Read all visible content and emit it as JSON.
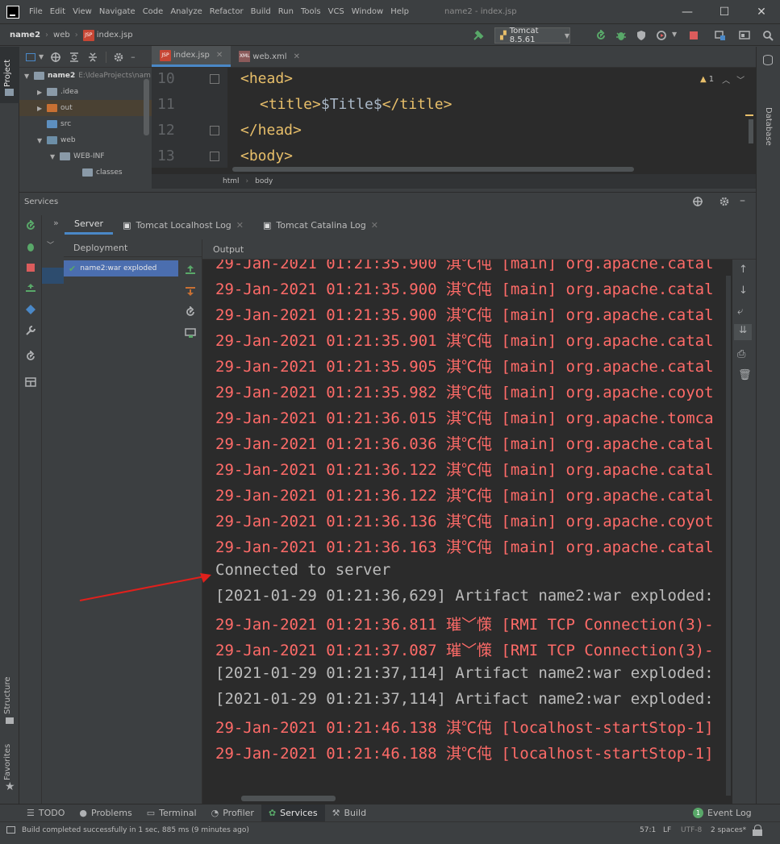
{
  "titlebar": {
    "menu": [
      "File",
      "Edit",
      "View",
      "Navigate",
      "Code",
      "Analyze",
      "Refactor",
      "Build",
      "Run",
      "Tools",
      "VCS",
      "Window",
      "Help"
    ],
    "window_title": "name2 - index.jsp",
    "minimize": "—",
    "maximize": "☐",
    "close": "✕"
  },
  "navbar": {
    "crumbs": [
      "name2",
      "web",
      "index.jsp"
    ],
    "jsp_badge": "JSP",
    "run_config": "Tomcat 8.5.61"
  },
  "left_strip": {
    "project": "Project",
    "structure": "Structure",
    "favorites": "Favorites"
  },
  "right_strip": {
    "database": "Database"
  },
  "project_tree": [
    {
      "label": "name2",
      "path": "E:\\IdeaProjects\\nam",
      "kind": "module"
    },
    {
      "label": ".idea",
      "kind": "folder"
    },
    {
      "label": "out",
      "kind": "folder-orange"
    },
    {
      "label": "src",
      "kind": "folder-blue"
    },
    {
      "label": "web",
      "kind": "folder-web"
    },
    {
      "label": "WEB-INF",
      "kind": "folder"
    },
    {
      "label": "classes",
      "kind": "folder"
    }
  ],
  "editor": {
    "tabs": [
      {
        "label": "index.jsp",
        "badge": "JSP"
      },
      {
        "label": "web.xml",
        "badge": "XML"
      }
    ],
    "warning_count": "1",
    "line_numbers": [
      "10",
      "11",
      "12",
      "13"
    ],
    "lines": [
      {
        "tag_open": "<head>",
        "text": "",
        "tag_close": ""
      },
      {
        "tag_open": "<title>",
        "text": "$Title$",
        "tag_close": "</title>"
      },
      {
        "tag_open": "</head>",
        "text": "",
        "tag_close": ""
      },
      {
        "tag_open": "<body>",
        "text": "",
        "tag_close": ""
      }
    ],
    "breadcrumb": [
      "html",
      "body"
    ]
  },
  "services": {
    "title": "Services",
    "tabs": [
      "Server",
      "Tomcat Localhost Log",
      "Tomcat Catalina Log"
    ],
    "deployment_header": "Deployment",
    "output_header": "Output",
    "deployment_item": "name2:war exploded"
  },
  "output_lines": [
    {
      "text": "29-Jan-2021 01:21:35.900 淇℃伅 [main] org.apache.catal",
      "kind": "err"
    },
    {
      "text": "29-Jan-2021 01:21:35.900 淇℃伅 [main] org.apache.catal",
      "kind": "err"
    },
    {
      "text": "29-Jan-2021 01:21:35.900 淇℃伅 [main] org.apache.catal",
      "kind": "err"
    },
    {
      "text": "29-Jan-2021 01:21:35.901 淇℃伅 [main] org.apache.catal",
      "kind": "err"
    },
    {
      "text": "29-Jan-2021 01:21:35.905 淇℃伅 [main] org.apache.catal",
      "kind": "err"
    },
    {
      "text": "29-Jan-2021 01:21:35.982 淇℃伅 [main] org.apache.coyot",
      "kind": "err"
    },
    {
      "text": "29-Jan-2021 01:21:36.015 淇℃伅 [main] org.apache.tomca",
      "kind": "err"
    },
    {
      "text": "29-Jan-2021 01:21:36.036 淇℃伅 [main] org.apache.catal",
      "kind": "err"
    },
    {
      "text": "29-Jan-2021 01:21:36.122 淇℃伅 [main] org.apache.catal",
      "kind": "err"
    },
    {
      "text": "29-Jan-2021 01:21:36.122 淇℃伅 [main] org.apache.catal",
      "kind": "err"
    },
    {
      "text": "29-Jan-2021 01:21:36.136 淇℃伅 [main] org.apache.coyot",
      "kind": "err"
    },
    {
      "text": "29-Jan-2021 01:21:36.163 淇℃伅 [main] org.apache.catal",
      "kind": "err"
    },
    {
      "text": "Connected to server",
      "kind": "norm"
    },
    {
      "text": "[2021-01-29 01:21:36,629] Artifact name2:war exploded:",
      "kind": "norm"
    },
    {
      "text": "29-Jan-2021 01:21:36.811 璀﹀憡 [RMI TCP Connection(3)-",
      "kind": "err"
    },
    {
      "text": "29-Jan-2021 01:21:37.087 璀﹀憡 [RMI TCP Connection(3)-",
      "kind": "err"
    },
    {
      "text": "[2021-01-29 01:21:37,114] Artifact name2:war exploded:",
      "kind": "norm"
    },
    {
      "text": "[2021-01-29 01:21:37,114] Artifact name2:war exploded:",
      "kind": "norm"
    },
    {
      "text": "29-Jan-2021 01:21:46.138 淇℃伅 [localhost-startStop-1]",
      "kind": "err"
    },
    {
      "text": "29-Jan-2021 01:21:46.188 淇℃伅 [localhost-startStop-1]",
      "kind": "err"
    }
  ],
  "bottom_tabs": [
    "TODO",
    "Problems",
    "Terminal",
    "Profiler",
    "Services",
    "Build",
    "Event Log"
  ],
  "event_log_count": "1",
  "status": {
    "message": "Build completed successfully in 1 sec, 885 ms (9 minutes ago)",
    "position": "57:1",
    "line_sep": "LF",
    "encoding": "UTF-8",
    "indent": "2 spaces*"
  },
  "colors": {
    "accent": "#4a88c7",
    "error_text": "#ff6b68",
    "arrow": "#e0201c",
    "run_green": "#59a869"
  }
}
